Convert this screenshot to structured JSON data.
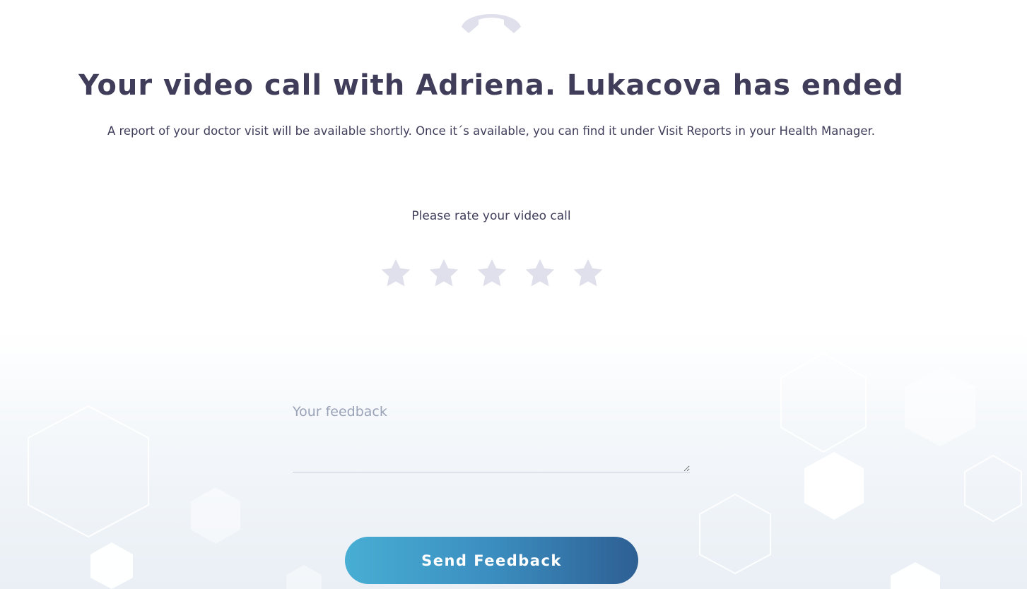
{
  "header": {
    "icon": "phone-hangup-icon",
    "title": "Your video call with Adriena. Lukacova has ended",
    "subtitle": "A report of your doctor visit will be available shortly. Once it´s available, you can find it under Visit Reports in your Health Manager."
  },
  "rating": {
    "label": "Please rate your video call",
    "max_stars": 5,
    "selected": 0,
    "star_color": "#dfe0ec"
  },
  "feedback": {
    "placeholder": "Your feedback",
    "value": ""
  },
  "actions": {
    "send_label": "Send Feedback"
  },
  "colors": {
    "text": "#3f3d5a",
    "button_start": "#48aed3",
    "button_end": "#2e5f93",
    "icon": "#dfe0ec"
  }
}
